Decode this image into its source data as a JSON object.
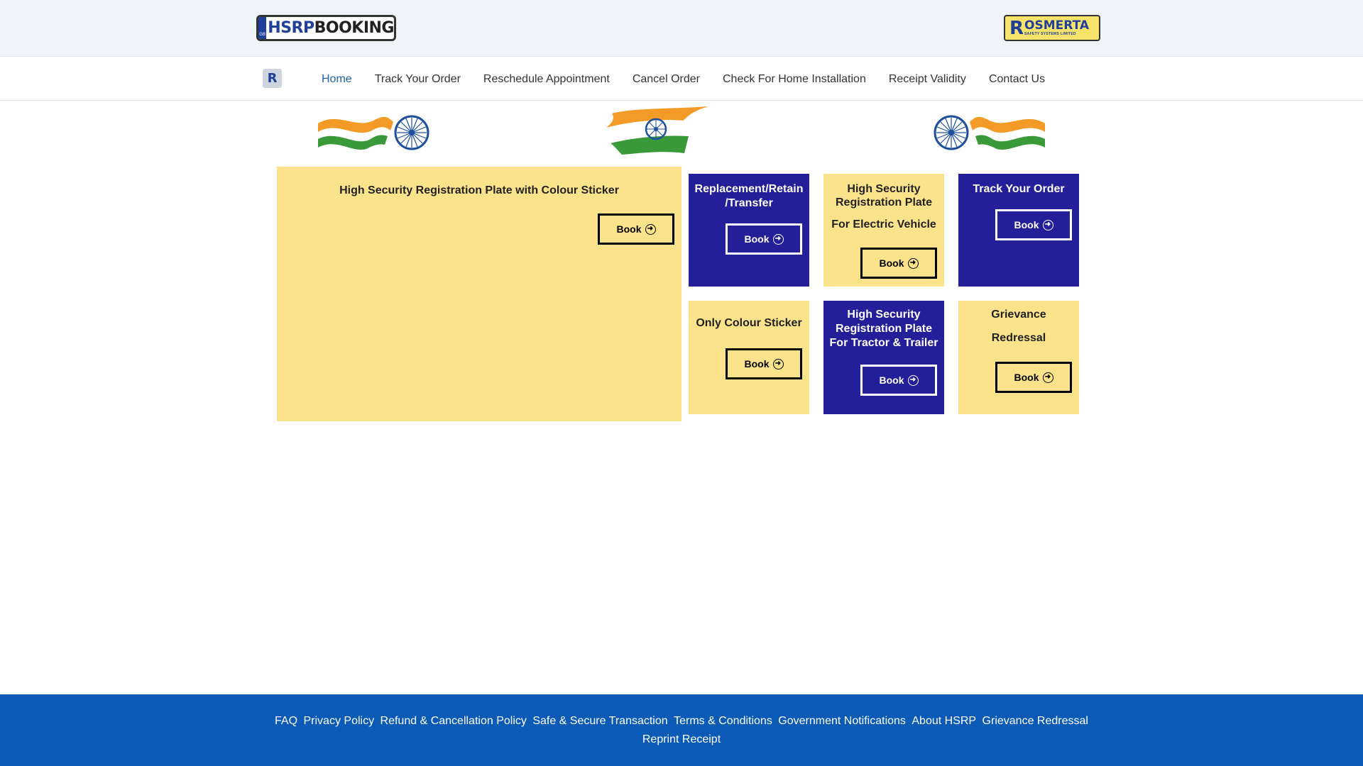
{
  "header": {
    "logo_left": {
      "part1": "HSRP",
      "part2": "BOOKING",
      "strip": "GB"
    },
    "logo_right": {
      "letter": "R",
      "name": "OSMERTA",
      "tagline": "SAFETY SYSTEMS LIMITED"
    }
  },
  "nav": {
    "brand_letter": "R",
    "items": [
      {
        "label": "Home",
        "active": true
      },
      {
        "label": "Track Your Order"
      },
      {
        "label": "Reschedule Appointment"
      },
      {
        "label": "Cancel Order"
      },
      {
        "label": "Check For Home Installation"
      },
      {
        "label": "Receipt Validity"
      },
      {
        "label": "Contact Us"
      }
    ]
  },
  "cards": {
    "main": {
      "title": "High Security Registration Plate with Colour Sticker",
      "button": "Book"
    },
    "replacement": {
      "title": "Replacement/Retain /Transfer",
      "button": "Book"
    },
    "electric": {
      "title": "High Security Registration Plate",
      "subtitle": "For Electric Vehicle",
      "button": "Book"
    },
    "track": {
      "title": "Track Your Order",
      "button": "Book"
    },
    "sticker": {
      "title": "Only Colour Sticker",
      "button": "Book"
    },
    "tractor": {
      "title": "High Security Registration Plate For Tractor & Trailer",
      "button": "Book"
    },
    "grievance": {
      "title": "Grievance",
      "subtitle": "Redressal",
      "button": "Book"
    }
  },
  "icons": {
    "arrow": "circle-arrow-right-icon"
  },
  "colors": {
    "yellow": "#fbe38c",
    "blue": "#221f99",
    "footer": "#0a5ab6",
    "nav_active": "#1f64b0"
  },
  "footer": {
    "links": [
      "FAQ",
      "Privacy Policy",
      "Refund & Cancellation Policy",
      "Safe & Secure Transaction",
      "Terms & Conditions",
      "Government Notifications",
      "About HSRP",
      "Grievance Redressal",
      "Reprint Receipt"
    ]
  }
}
